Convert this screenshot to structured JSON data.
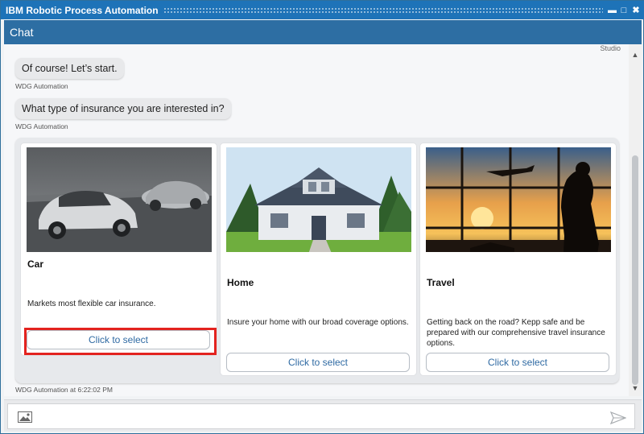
{
  "window": {
    "title": "IBM Robotic Process Automation"
  },
  "chat_header": {
    "title": "Chat"
  },
  "studio_label": "Studio",
  "messages": [
    {
      "text": "Of course! Let’s start.",
      "sender": "WDG Automation"
    },
    {
      "text": "What type of insurance you are interested in?",
      "sender": "WDG Automation"
    }
  ],
  "cards": [
    {
      "title": "Car",
      "description": "Markets most flexible car insurance.",
      "button": "Click to select"
    },
    {
      "title": "Home",
      "description": "Insure your home with our broad coverage options.",
      "button": "Click to select"
    },
    {
      "title": "Travel",
      "description": "Getting back on the road? Kepp safe and be prepared with our comprehensive travel insurance options.",
      "button": "Click to select"
    }
  ],
  "timestamp": "WDG Automation at 6:22:02 PM",
  "colors": {
    "titlebar": "#1e73b8",
    "chat_header": "#2d6ea3",
    "button_text": "#2f6aa3",
    "highlight": "#e3231f"
  },
  "icons": {
    "attach": "image-icon",
    "send": "send-icon"
  }
}
